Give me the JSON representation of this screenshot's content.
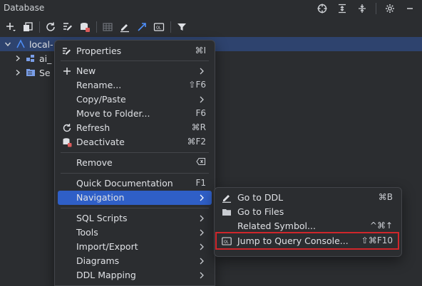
{
  "panel": {
    "title": "Database"
  },
  "tree": {
    "items": [
      {
        "label": "local-"
      },
      {
        "label": "ai_"
      },
      {
        "label": "Se"
      }
    ]
  },
  "context_menu": {
    "items": [
      {
        "label": "Properties",
        "shortcut": "⌘I",
        "icon": "properties-icon"
      },
      {
        "label": "New",
        "submenu": true,
        "icon": "plus-icon"
      },
      {
        "label": "Rename...",
        "shortcut": "⇧F6"
      },
      {
        "label": "Copy/Paste",
        "submenu": true
      },
      {
        "label": "Move to Folder...",
        "shortcut": "F6"
      },
      {
        "label": "Refresh",
        "shortcut": "⌘R",
        "icon": "refresh-icon"
      },
      {
        "label": "Deactivate",
        "shortcut": "⌘F2",
        "icon": "deactivate-icon"
      },
      {
        "label": "Remove",
        "shortcut_icon": "delete-key-icon"
      },
      {
        "label": "Quick Documentation",
        "shortcut": "F1"
      },
      {
        "label": "Navigation",
        "submenu": true,
        "active": true
      },
      {
        "label": "SQL Scripts",
        "submenu": true
      },
      {
        "label": "Tools",
        "submenu": true
      },
      {
        "label": "Import/Export",
        "submenu": true
      },
      {
        "label": "Diagrams",
        "submenu": true
      },
      {
        "label": "DDL Mapping",
        "submenu": true
      }
    ]
  },
  "navigation_submenu": {
    "items": [
      {
        "label": "Go to DDL",
        "shortcut": "⌘B",
        "icon": "edit-ddl-icon"
      },
      {
        "label": "Go to Files",
        "icon": "folder-icon"
      },
      {
        "label": "Related Symbol...",
        "shortcut": "^⌘↑"
      },
      {
        "label": "Jump to Query Console...",
        "shortcut": "⇧⌘F10",
        "icon": "query-console-icon",
        "highlighted": true
      }
    ]
  },
  "colors": {
    "background": "#2b2d30",
    "selection": "#2e436e",
    "menu_active": "#2f5fc7",
    "highlight_border": "#d0262b",
    "accent_blue": "#4e8ef7"
  }
}
